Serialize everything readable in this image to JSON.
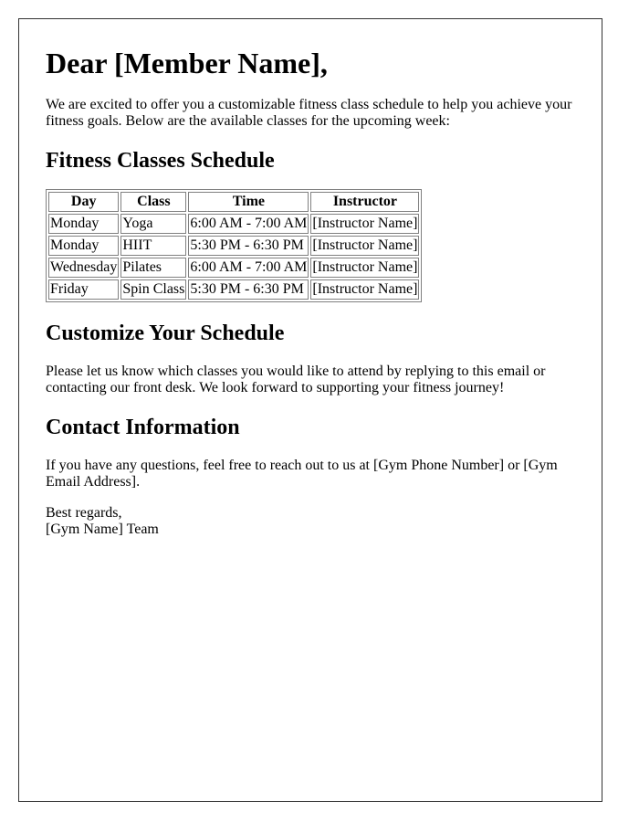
{
  "greeting": "Dear [Member Name],",
  "intro": "We are excited to offer you a customizable fitness class schedule to help you achieve your fitness goals. Below are the available classes for the upcoming week:",
  "schedule": {
    "heading": "Fitness Classes Schedule",
    "columns": [
      "Day",
      "Class",
      "Time",
      "Instructor"
    ],
    "rows": [
      [
        "Monday",
        "Yoga",
        "6:00 AM - 7:00 AM",
        "[Instructor Name]"
      ],
      [
        "Monday",
        "HIIT",
        "5:30 PM - 6:30 PM",
        "[Instructor Name]"
      ],
      [
        "Wednesday",
        "Pilates",
        "6:00 AM - 7:00 AM",
        "[Instructor Name]"
      ],
      [
        "Friday",
        "Spin Class",
        "5:30 PM - 6:30 PM",
        "[Instructor Name]"
      ]
    ]
  },
  "customize": {
    "heading": "Customize Your Schedule",
    "text": "Please let us know which classes you would like to attend by replying to this email or contacting our front desk. We look forward to supporting your fitness journey!"
  },
  "contact": {
    "heading": "Contact Information",
    "text": "If you have any questions, feel free to reach out to us at [Gym Phone Number] or [Gym Email Address]."
  },
  "signoff": {
    "closing": "Best regards,",
    "signature": "[Gym Name] Team"
  }
}
